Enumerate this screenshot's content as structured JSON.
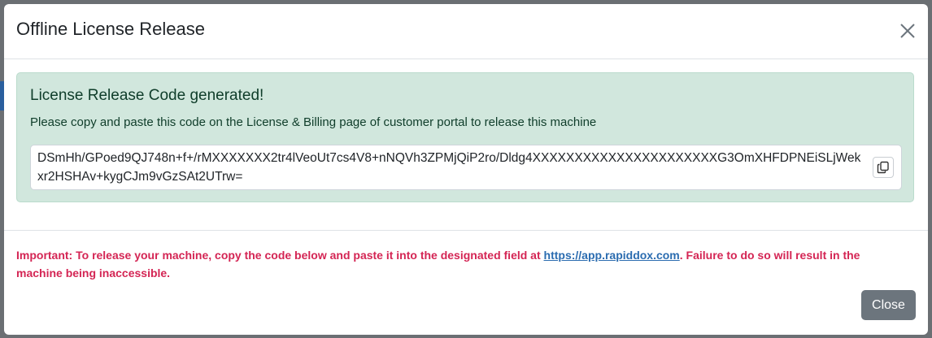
{
  "modal": {
    "title": "Offline License Release",
    "alert": {
      "heading": "License Release Code generated!",
      "text": "Please copy and paste this code on the License & Billing page of customer portal to release this machine",
      "code": "DSmHh/GPoed9QJ748n+f+/rMXXXXXXX2tr4lVeoUt7cs4V8+nNQVh3ZPMjQiP2ro/Dldg4XXXXXXXXXXXXXXXXXXXXXXG3OmXHFDPNEiSLjWekxr2HSHAv+kygCJm9vGzSAt2UTrw="
    },
    "footer": {
      "important_label": "Important:",
      "important_text_1": " To release your machine, copy the code below and paste it into the designated field at ",
      "link_text": "https://app.rapiddox.com",
      "important_text_2": ". Failure to do so will result in the machine being inaccessible.",
      "close_label": "Close"
    }
  },
  "colors": {
    "alert_bg": "#d1e7dd",
    "important": "#d42554",
    "link": "#2b6cb0",
    "close_btn": "#6c757d"
  },
  "icons": [
    "close-icon",
    "copy-icon"
  ]
}
